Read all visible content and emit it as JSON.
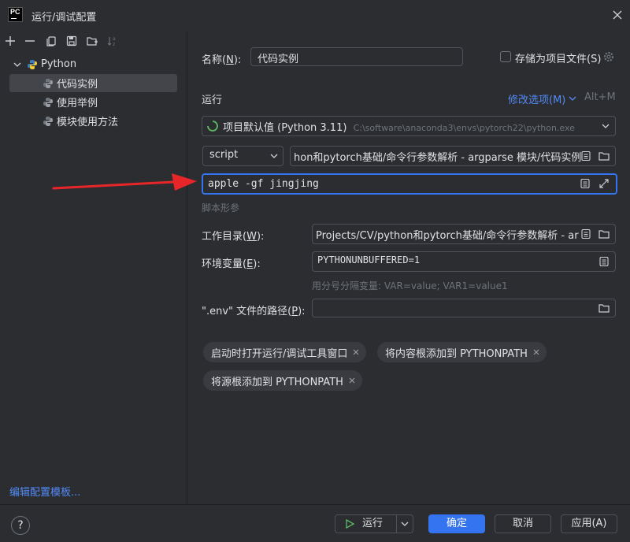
{
  "window": {
    "title": "运行/调试配置",
    "logo_text": "PC"
  },
  "tree": {
    "group": "Python",
    "items": [
      "代码实例",
      "使用举例",
      "模块使用方法"
    ],
    "selected_index": 0
  },
  "left_footer": {
    "edit_templates": "编辑配置模板..."
  },
  "form": {
    "name_label": "名称(",
    "name_mnemonic": "N",
    "name_label_end": "):",
    "name_value": "代码实例",
    "store_label": "存储为项目文件(S)",
    "run_section": "运行",
    "modify_options": "修改选项(M)",
    "modify_shortcut": "Alt+M",
    "interpreter_name": "项目默认值 (Python 3.11)",
    "interpreter_path": "C:\\software\\anaconda3\\envs\\pytorch22\\python.exe",
    "script_type": "script",
    "script_path": "hon和pytorch基础/命令行参数解析 - argparse 模块/代码实例",
    "params_value": "apple -gf jingjing",
    "params_hint": "脚本形参",
    "workdir_label": "工作目录(",
    "workdir_mnemonic": "W",
    "workdir_label_end": "):",
    "workdir_value": "Projects/CV/python和pytorch基础/命令行参数解析 - ar",
    "env_label": "环境变量(",
    "env_mnemonic": "E",
    "env_label_end": "):",
    "env_value": "PYTHONUNBUFFERED=1",
    "env_hint": "用分号分隔变量: VAR=value; VAR1=value1",
    "dotenv_label": "\".env\" 文件的路径(",
    "dotenv_mnemonic": "P",
    "dotenv_label_end": "):",
    "dotenv_value": "",
    "chips": [
      "启动时打开运行/调试工具窗口",
      "将内容根添加到 PYTHONPATH",
      "将源根添加到 PYTHONPATH"
    ]
  },
  "footer": {
    "help": "?",
    "run": "运行",
    "ok": "确定",
    "cancel": "取消",
    "apply": "应用(A)"
  },
  "colors": {
    "accent": "#3574f0",
    "link": "#548af7",
    "annotation_arrow": "#e8262a",
    "python_blue": "#3d7ab8",
    "python_yellow": "#f0c93c"
  }
}
